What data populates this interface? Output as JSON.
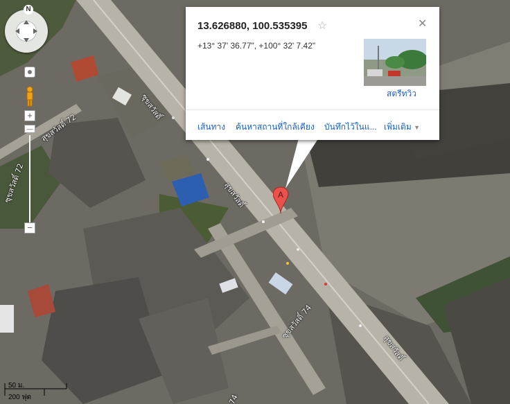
{
  "infowindow": {
    "coords_title": "13.626880, 100.535395",
    "dms": "+13° 37' 36.77\", +100° 32' 7.42\"",
    "streetview_label": "สตรีทวิว",
    "actions": [
      "เส้นทาง",
      "ค้นหาสถานที่ใกล้เคียง",
      "บันทึกไว้ในแ...",
      "เพิ่มเติม"
    ]
  },
  "marker": {
    "label": "A"
  },
  "controls": {
    "compass_label": "N",
    "zoom_in": "+",
    "zoom_out": "−"
  },
  "scale": {
    "metric": "50 ม.",
    "imperial": "200 ฟุต"
  },
  "road_labels": [
    "สุขสวัสดิ์ 72",
    "ซุขสวัสดิ์",
    "สุขสวัสดิ์",
    "ซุขสวัสดิ์ 74",
    "สุขสวัสดิ์",
    "ซุขสวัสดิ์ 72",
    "74"
  ],
  "colors": {
    "marker_red": "#e8524a",
    "link_blue": "#1a5ec4",
    "road": "#bdb8ae"
  }
}
